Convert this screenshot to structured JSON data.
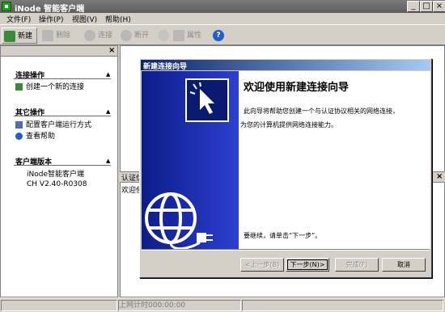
{
  "titlebar": {
    "title": "iNode 智能客户端",
    "min": "_",
    "max": "□",
    "close": "×"
  },
  "menu": [
    "文件(F)",
    "操作(P)",
    "视图(V)",
    "帮助(H)"
  ],
  "toolbar": {
    "new": "新建",
    "delete": "删除",
    "connect": "连接",
    "disconnect": "断开",
    "properties": "属性"
  },
  "left": {
    "close": "×",
    "sections": [
      {
        "title": "连接操作",
        "links": [
          "创建一个新的连接"
        ]
      },
      {
        "title": "其它操作",
        "links": [
          "配置客户端运行方式",
          "查看帮助"
        ]
      },
      {
        "title": "客户端版本",
        "lines": [
          "iNode智能客户端",
          "CH V2.40-R0308"
        ]
      }
    ]
  },
  "main": {
    "auth_label": "认证信",
    "auth_close": "×",
    "welcome_fragment": "欢迎使"
  },
  "statusbar": {
    "timer": "上网计时000:00:00"
  },
  "wizard": {
    "title": "新建连接向导",
    "heading": "欢迎使用新建连接向导",
    "desc1": "此向导将帮助您创建一个与认证协议相关的网络连接，",
    "desc2": "为您的计算机提供网络连接能力。",
    "continue": "要继续，请单击“下一步”。",
    "buttons": {
      "back": "<上一步(B)",
      "next": "下一步(N)>",
      "finish": "完成(F)",
      "cancel": "取消"
    }
  },
  "colors": {
    "wizard_side": "#1a2ab0",
    "title_active": "#0a246a",
    "app_icon": "#1d9e1d"
  }
}
